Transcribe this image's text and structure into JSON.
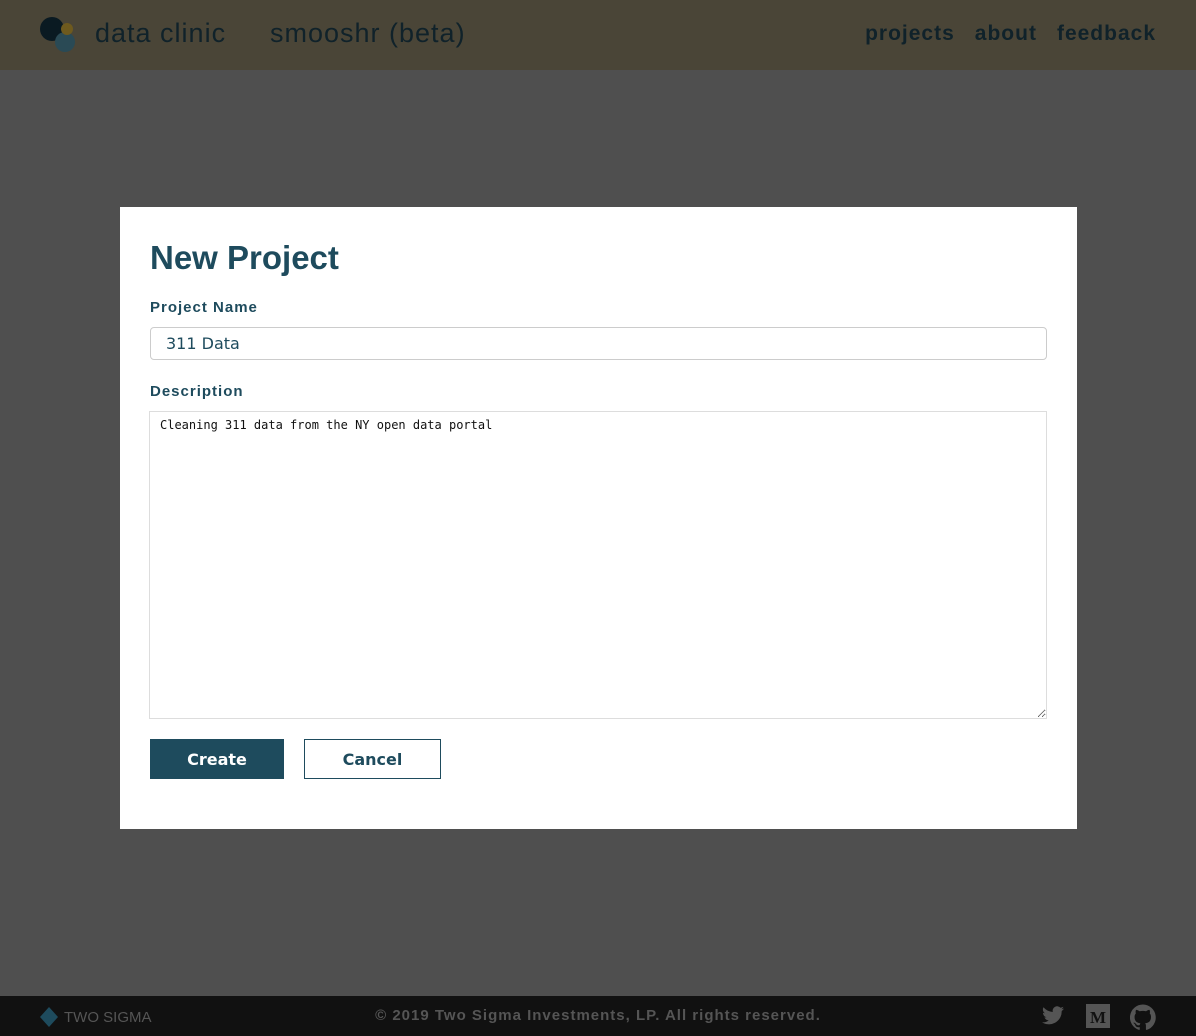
{
  "header": {
    "brand": "data clinic",
    "app_name": "smooshr (beta)",
    "nav": [
      "projects",
      "about",
      "feedback"
    ]
  },
  "modal": {
    "title": "New Project",
    "name_label": "Project Name",
    "name_value": "311 Data",
    "description_label": "Description",
    "description_value": "Cleaning 311 data from the NY open data portal",
    "create_label": "Create",
    "cancel_label": "Cancel"
  },
  "footer": {
    "logo_text": "TWO SIGMA",
    "copyright": "© 2019 Two Sigma Investments, LP. All rights reserved."
  }
}
